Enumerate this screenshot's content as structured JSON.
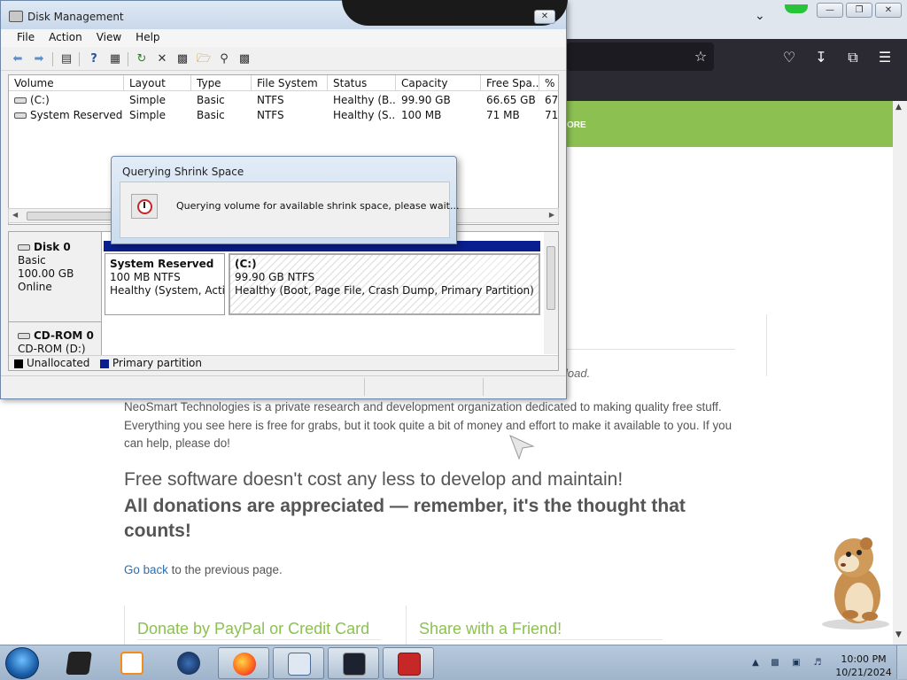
{
  "browser": {
    "site_banner_text": "ORE",
    "download_tail": "load.",
    "intro_paragraph": "NeoSmart Technologies is a private research and development organization dedicated to making quality free stuff. Everything you see here is free for grabs, but it took quite a bit of money and effort to make it available to you. If you can help, please do!",
    "headline_1": "Free software doesn't cost any less to develop and maintain!",
    "headline_2": "All donations are appreciated — remember, it's the thought that counts!",
    "go_back_link": "Go back",
    "go_back_rest": " to the previous page.",
    "cta_paypal": "Donate by PayPal or Credit Card",
    "cta_share": "Share with a Friend!"
  },
  "disk_management": {
    "title": "Disk Management",
    "menu": [
      "File",
      "Action",
      "View",
      "Help"
    ],
    "columns": [
      "Volume",
      "Layout",
      "Type",
      "File System",
      "Status",
      "Capacity",
      "Free Spa...",
      "% F"
    ],
    "volumes": [
      {
        "volume": "(C:)",
        "layout": "Simple",
        "type": "Basic",
        "fs": "NTFS",
        "status": "Healthy (B...",
        "capacity": "99.90 GB",
        "free": "66.65 GB",
        "pct": "67"
      },
      {
        "volume": "System Reserved",
        "layout": "Simple",
        "type": "Basic",
        "fs": "NTFS",
        "status": "Healthy (S...",
        "capacity": "100 MB",
        "free": "71 MB",
        "pct": "71"
      }
    ],
    "disk0": {
      "name": "Disk 0",
      "type": "Basic",
      "size": "100.00 GB",
      "state": "Online"
    },
    "cdrom": {
      "name": "CD-ROM 0",
      "drive": "CD-ROM (D:)"
    },
    "partition_sysres": {
      "name": "System Reserved",
      "size": "100 MB NTFS",
      "status": "Healthy (System, Active, Primary Partition)"
    },
    "partition_c": {
      "name": "(C:)",
      "size": "99.90 GB NTFS",
      "status": "Healthy (Boot, Page File, Crash Dump, Primary Partition)"
    },
    "legend": [
      {
        "label": "Unallocated",
        "color": "#000000"
      },
      {
        "label": "Primary partition",
        "color": "#0a1f8f"
      }
    ]
  },
  "dialog": {
    "title": "Querying Shrink Space",
    "message": "Querying volume for available shrink space, please wait..."
  },
  "taskbar": {
    "time": "10:00 PM",
    "date": "10/21/2024"
  },
  "colors": {
    "site_green": "#8cc152",
    "partition_blue": "#0a1f8f"
  }
}
